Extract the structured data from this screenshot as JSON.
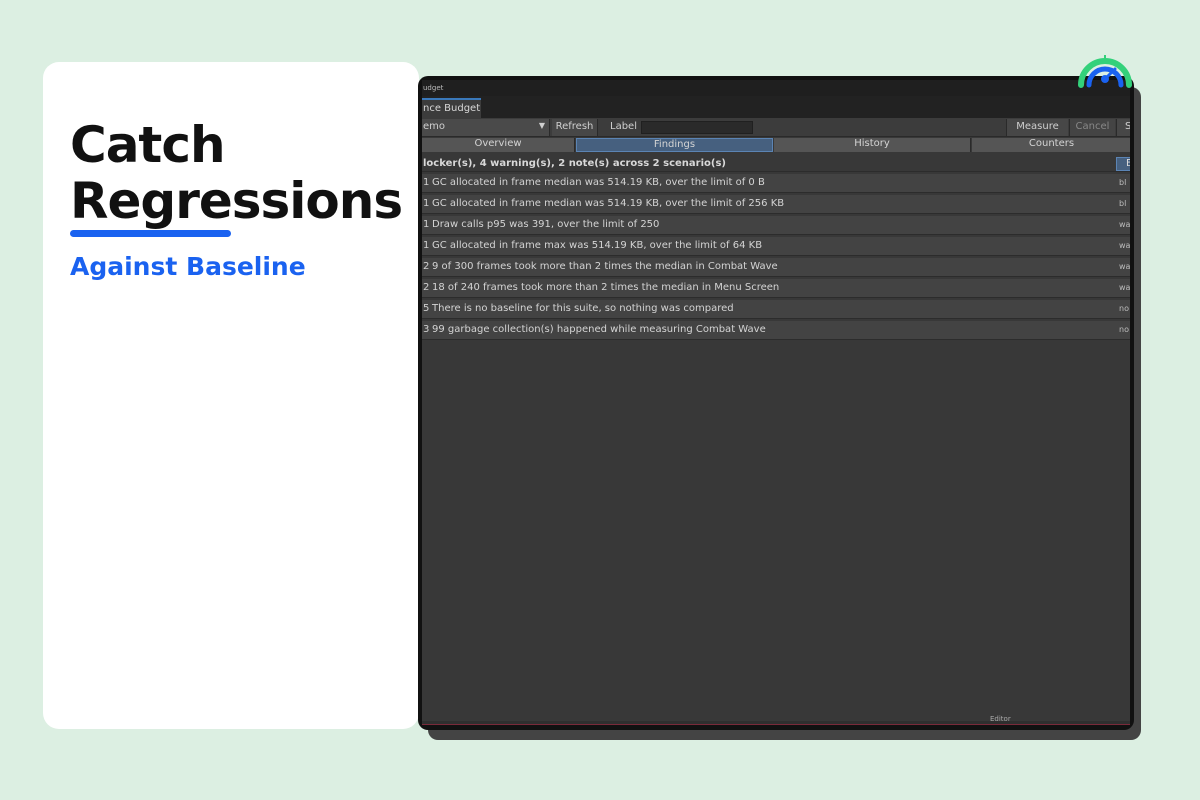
{
  "promo": {
    "line1": "Catch",
    "line2": "Regressions",
    "subhead": "Against Baseline",
    "accent_color": "#1a62f0"
  },
  "window": {
    "title": "udget",
    "tab_label": "nce Budget",
    "toolbar": {
      "scenario_value": "emo",
      "refresh_label": "Refresh",
      "label_label": "Label",
      "label_input_value": "",
      "measure_label": "Measure",
      "cancel_label": "Cancel",
      "extra_label": "S"
    },
    "view_tabs": [
      {
        "label": "Overview",
        "active": false
      },
      {
        "label": "Findings",
        "active": true
      },
      {
        "label": "History",
        "active": false
      },
      {
        "label": "Counters",
        "active": false
      }
    ],
    "summary": "locker(s), 4 warning(s), 2 note(s) across 2 scenario(s)",
    "export_label": "E",
    "findings": [
      {
        "idx": "1",
        "message": "GC allocated in frame median was 514.19 KB, over the limit of 0 B",
        "severity": "bl"
      },
      {
        "idx": "1",
        "message": "GC allocated in frame median was 514.19 KB, over the limit of 256 KB",
        "severity": "bl"
      },
      {
        "idx": "1",
        "message": "Draw calls p95 was 391, over the limit of 250",
        "severity": "wa"
      },
      {
        "idx": "1",
        "message": "GC allocated in frame max was 514.19 KB, over the limit of 64 KB",
        "severity": "wa"
      },
      {
        "idx": "2",
        "message": "9 of 300 frames took more than 2 times the median in Combat Wave",
        "severity": "wa"
      },
      {
        "idx": "2",
        "message": "18 of 240 frames took more than 2 times the median in Menu Screen",
        "severity": "wa"
      },
      {
        "idx": "5",
        "message": "There is no baseline for this suite, so nothing was compared",
        "severity": "no"
      },
      {
        "idx": "3",
        "message": "99 garbage collection(s) happened while measuring Combat Wave",
        "severity": "no"
      }
    ],
    "status_label": "Editor"
  },
  "logo": {
    "icon": "gauge-icon",
    "colors": [
      "#33d17a",
      "#1a62f0"
    ]
  }
}
